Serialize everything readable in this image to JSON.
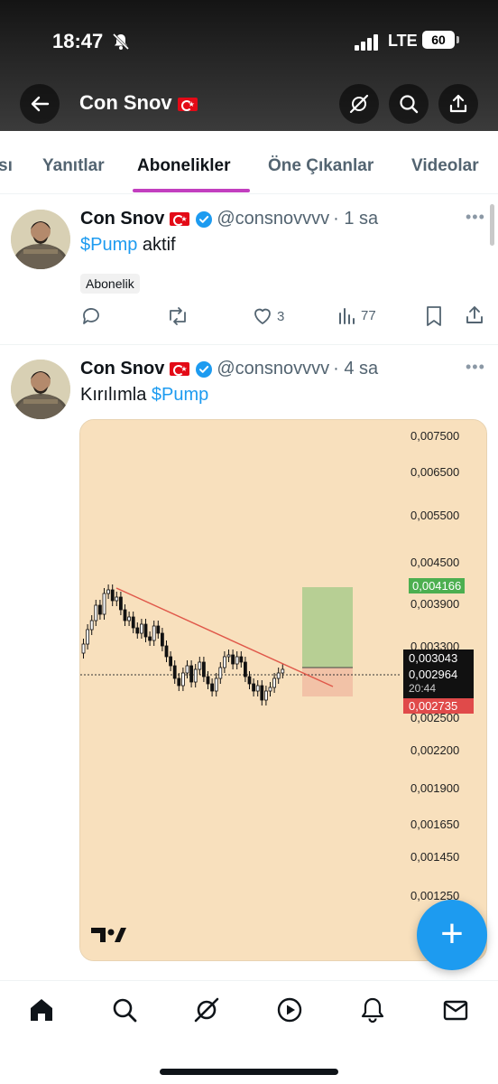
{
  "status_bar": {
    "time": "18:47",
    "network": "LTE",
    "battery": "60"
  },
  "header": {
    "title": "Con Snov"
  },
  "tabs": [
    {
      "label": "sı",
      "active": false
    },
    {
      "label": "Yanıtlar",
      "active": false
    },
    {
      "label": "Abonelikler",
      "active": true
    },
    {
      "label": "Öne Çıkanlar",
      "active": false
    },
    {
      "label": "Videolar",
      "active": false
    }
  ],
  "tweets": [
    {
      "name": "Con Snov",
      "handle": "@consnovvvv",
      "time": "· 1 sa",
      "cashtag": "$Pump",
      "text": " aktif",
      "badge": "Abonelik",
      "likes": "3",
      "views": "77"
    },
    {
      "name": "Con Snov",
      "handle": "@consnovvvv",
      "time": "· 4 sa",
      "text_prefix": "Kırılımla ",
      "cashtag": "$Pump"
    }
  ],
  "chart_data": {
    "type": "candlestick",
    "background": "#f8e0bd",
    "y_ticks": [
      "0,007500",
      "0,006500",
      "0,005500",
      "0,004500",
      "0,003900",
      "0,003300",
      "0,002500",
      "0,002200",
      "0,001900",
      "0,001650",
      "0,001450",
      "0,001250"
    ],
    "labels": {
      "target": "0,004166",
      "entry": "0,003043",
      "current": "0,002964",
      "countdown": "20:44",
      "stop": "0,002735"
    },
    "colors": {
      "target": "#4caf50",
      "stop": "#e04a4a",
      "current": "#111111",
      "trendline": "#e0584a",
      "profit_zone": "#b7cf94",
      "loss_zone": "#f2c2a7"
    }
  }
}
